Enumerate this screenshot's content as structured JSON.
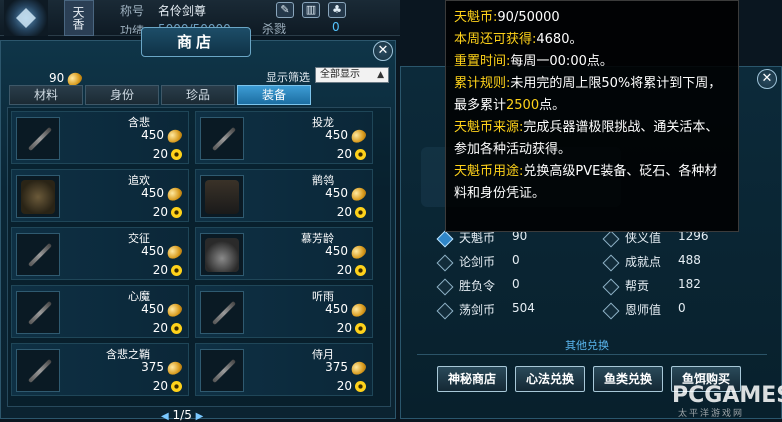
{
  "topbar": {
    "faction": "天香",
    "title_label": "称号",
    "title_value": "名伶剑尊",
    "merit_label": "功绩",
    "merit_value": "5000/50000",
    "kill_label": "杀戮",
    "kill_value": "0"
  },
  "shop": {
    "title": "商店",
    "currency_amount": "90",
    "filter_label": "显示筛选",
    "filter_value": "全部显示",
    "tabs": [
      {
        "label": "材料",
        "active": false
      },
      {
        "label": "身份",
        "active": false
      },
      {
        "label": "珍品",
        "active": false
      },
      {
        "label": "装备",
        "active": true
      }
    ],
    "items": [
      {
        "name": "含悲",
        "price1": "450",
        "price2": "20",
        "pic": "weapon"
      },
      {
        "name": "投龙",
        "price1": "450",
        "price2": "20",
        "pic": "weapon"
      },
      {
        "name": "追欢",
        "price1": "450",
        "price2": "20",
        "pic": "armor"
      },
      {
        "name": "鹡鸰",
        "price1": "450",
        "price2": "20",
        "pic": "figure"
      },
      {
        "name": "交征",
        "price1": "450",
        "price2": "20",
        "pic": "weapon"
      },
      {
        "name": "慕芳龄",
        "price1": "450",
        "price2": "20",
        "pic": "umbrella"
      },
      {
        "name": "心魔",
        "price1": "450",
        "price2": "20",
        "pic": "weapon"
      },
      {
        "name": "听雨",
        "price1": "450",
        "price2": "20",
        "pic": "weapon"
      },
      {
        "name": "含悲之鞘",
        "price1": "375",
        "price2": "20",
        "pic": "weapon"
      },
      {
        "name": "侍月",
        "price1": "375",
        "price2": "20",
        "pic": "weapon"
      }
    ],
    "pager": "1/5"
  },
  "info": {
    "stats": [
      {
        "label": "天魁币",
        "value": "90",
        "highlight": true
      },
      {
        "label": "侠义值",
        "value": "1296",
        "highlight": false
      },
      {
        "label": "论剑币",
        "value": "0",
        "highlight": false
      },
      {
        "label": "成就点",
        "value": "488",
        "highlight": false
      },
      {
        "label": "胜负令",
        "value": "0",
        "highlight": false
      },
      {
        "label": "帮贡",
        "value": "182",
        "highlight": false
      },
      {
        "label": "荡剑币",
        "value": "504",
        "highlight": false
      },
      {
        "label": "恩师值",
        "value": "0",
        "highlight": false
      }
    ],
    "other_link": "其他兑换",
    "buttons": [
      "神秘商店",
      "心法兑换",
      "鱼类兑换",
      "鱼饵购买"
    ]
  },
  "tooltip": {
    "l1_key": "天魁币:",
    "l1_val": "90/50000",
    "l2_key": "本周还可获得:",
    "l2_val": "4680。",
    "l3_key": "重置时间:",
    "l3_val": "每周一00:00点。",
    "l4_key": "累计规则:",
    "l4_val_a": "未用完的周上限50%将累计到下周，最多累计",
    "l4_val_hl": "2500",
    "l4_val_b": "点。",
    "l5_key": "天魁币来源:",
    "l5_val": "完成兵器谱极限挑战、通关活本、参加各种活动获得。",
    "l6_key": "天魁币用途:",
    "l6_val": "兑换高级PVE装备、砭石、各种材料和身份凭证。"
  },
  "watermark": {
    "main": "PCGAMES",
    "sub": "太平洋游戏网"
  },
  "colors": {
    "accent": "#ffd21a",
    "link": "#5ab6ee",
    "tab_active": "#2f86c8"
  }
}
